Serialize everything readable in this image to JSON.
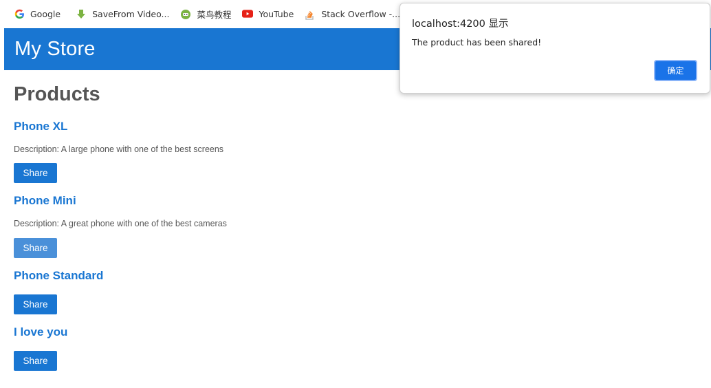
{
  "bookmarks": [
    {
      "label": "Google",
      "icon": "google-icon"
    },
    {
      "label": "SaveFrom Video...",
      "icon": "download-arrow-icon"
    },
    {
      "label": "菜鸟教程",
      "icon": "runoob-icon"
    },
    {
      "label": "YouTube",
      "icon": "youtube-icon"
    },
    {
      "label": "Stack Overflow -...",
      "icon": "stackoverflow-icon"
    }
  ],
  "header": {
    "title": "My Store",
    "color": "#1976d2"
  },
  "main": {
    "title": "Products",
    "products": [
      {
        "name": "Phone XL",
        "description": "Description: A large phone with one of the best screens",
        "share_label": "Share"
      },
      {
        "name": "Phone Mini",
        "description": "Description: A great phone with one of the best cameras",
        "share_label": "Share"
      },
      {
        "name": "Phone Standard",
        "description": "",
        "share_label": "Share"
      },
      {
        "name": "I love you",
        "description": "",
        "share_label": "Share"
      }
    ]
  },
  "dialog": {
    "title": "localhost:4200 显示",
    "message": "The product has been shared!",
    "ok_label": "确定"
  }
}
